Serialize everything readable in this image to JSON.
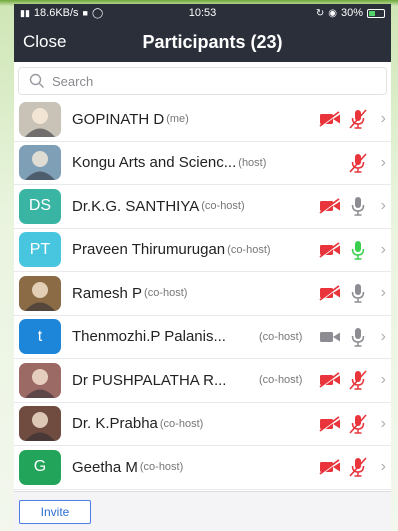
{
  "status_bar": {
    "network": "18.6KB/s",
    "time": "10:53",
    "battery": "30%"
  },
  "header": {
    "close_label": "Close",
    "title": "Participants (23)"
  },
  "search": {
    "placeholder": "Search"
  },
  "participants": [
    {
      "name": "GOPINATH D",
      "role": "(me)",
      "avatar": {
        "type": "photo",
        "bg": "#c9c2b6"
      },
      "video_muted": true,
      "audio": "muted"
    },
    {
      "name": "Kongu Arts and Scienc...",
      "role": "(host)",
      "avatar": {
        "type": "photo",
        "bg": "#7f9fb7"
      },
      "video_muted": null,
      "audio": "muted"
    },
    {
      "name": "Dr.K.G. SANTHIYA",
      "role": "(co-host)",
      "avatar": {
        "type": "initials",
        "initials": "DS",
        "bg": "#3bb5a3"
      },
      "video_muted": true,
      "audio": "on"
    },
    {
      "name": "Praveen Thirumurugan",
      "role": "(co-host)",
      "avatar": {
        "type": "initials",
        "initials": "PT",
        "bg": "#48c6e0"
      },
      "video_muted": true,
      "audio": "speaking"
    },
    {
      "name": "Ramesh P",
      "role": "(co-host)",
      "avatar": {
        "type": "photo",
        "bg": "#8a6b46"
      },
      "video_muted": true,
      "audio": "on"
    },
    {
      "name": "Thenmozhi.P Palanis...",
      "role": "(co-host)",
      "avatar": {
        "type": "initials",
        "initials": "t",
        "bg": "#1e86d8"
      },
      "video_muted": false,
      "audio": "on"
    },
    {
      "name": "Dr PUSHPALATHA R...",
      "role": "(co-host)",
      "avatar": {
        "type": "photo",
        "bg": "#9c6a64"
      },
      "video_muted": true,
      "audio": "muted"
    },
    {
      "name": "Dr. K.Prabha",
      "role": "(co-host)",
      "avatar": {
        "type": "photo",
        "bg": "#6f4c3f"
      },
      "video_muted": true,
      "audio": "muted"
    },
    {
      "name": "Geetha M",
      "role": "(co-host)",
      "avatar": {
        "type": "initials",
        "initials": "G",
        "bg": "#22a55a"
      },
      "video_muted": true,
      "audio": "muted"
    }
  ],
  "footer": {
    "invite_label": "Invite"
  },
  "colors": {
    "muted_red": "#e8343a",
    "gray_icon": "#8c8c92",
    "speaking_green": "#3ccf4e",
    "header_bg": "#2a2f3a"
  }
}
